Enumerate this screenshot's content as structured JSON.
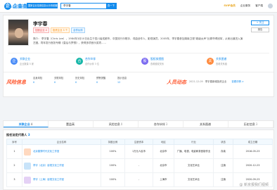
{
  "header": {
    "logo_char": "企",
    "logo_text": "企查查",
    "logo_sub": "QICHACHA.COM",
    "logo_badge": "国家企业信用信息公示系统备案",
    "search_value": "李宇春",
    "search_button": "查一下",
    "vip_label": "SVIP会员",
    "nav_items": [
      "企业服务",
      "客户端"
    ]
  },
  "profile": {
    "name": "李宇春",
    "tags": [
      "控股企业 4",
      "投资企业 3 个",
      "合作伙伴"
    ],
    "description": "简介： 李宇春（Chris Lee），1984年3月10日出生于四川省成都市，中国流行乐歌手、词曲创作人、影视演员。2005年，李宇春参加湖南卫视“超级女声”比赛夺得冠军，从而出道进入演艺圈。同年发行首张专辑《皇后与梦想》，获得多项音乐奖项......",
    "follow_label": "+ 关注",
    "report_label": "报告",
    "quick_links": [
      {
        "icon": "企",
        "title": "关联企业",
        "sub": "企业数量 5 家",
        "color": "#4a8cf7"
      },
      {
        "icon": "合",
        "title": "合作伙伴",
        "sub": "合作伙伴 3 位",
        "color": "#16b6a8"
      },
      {
        "icon": "股",
        "title": "股权穿透图",
        "sub": "查看股权关系",
        "color": "#7a6af0"
      },
      {
        "icon": "关",
        "title": "关系图谱",
        "sub": "查看关系链",
        "color": "#ff8a3d"
      }
    ],
    "brand_left": "风险信息",
    "stats": [
      {
        "label": "自身风险",
        "value": "0"
      },
      {
        "label": "关联风险",
        "value": "0"
      },
      {
        "label": "历史风险",
        "value": "0"
      },
      {
        "label": "预警提醒",
        "value": "0"
      },
      {
        "label": "提示信息",
        "value": "12"
      }
    ],
    "brand_right": "人员动态",
    "news_date": "2021-12-09",
    "news_text": "李宇春新增投资企业",
    "news_link": "查看详情 >"
  },
  "tabs": [
    {
      "label": "关联企业",
      "count": "4"
    },
    {
      "label": "董监高",
      "count": ""
    },
    {
      "label": "风险信息",
      "count": "0"
    },
    {
      "label": "合作伙伴",
      "count": "3"
    },
    {
      "label": "关系图谱",
      "count": ""
    },
    {
      "label": "历史信息",
      "count": "3"
    }
  ],
  "section": {
    "title": "担任法定代表人",
    "count": "3",
    "columns": [
      "序号",
      "企业名称",
      "持股比例",
      "注册资本",
      "地区",
      "行业",
      "状态",
      "成立日期"
    ],
    "rows": [
      {
        "no": "1",
        "name": "北京春秀时代文化工作室",
        "share": "100%",
        "capital": "1万元人民币",
        "region": "北京市",
        "industry": "广播、电视、电影和录音制作业",
        "status": "存续",
        "date": "2016-05-23"
      },
      {
        "no": "2",
        "name": "李宇（北京）影视文化工作室",
        "share": "100%",
        "capital": "-",
        "region": "北京市",
        "industry": "文化艺术业",
        "status": "注销",
        "date": "2020-12-23"
      },
      {
        "no": "3",
        "name": "李宇（上海）影视文化工作室",
        "share": "100%",
        "capital": "-",
        "region": "上海市",
        "industry": "文化艺术业",
        "status": "注销",
        "date": "2020-09-23"
      }
    ]
  },
  "watermark": "@ 新京报我们视频"
}
